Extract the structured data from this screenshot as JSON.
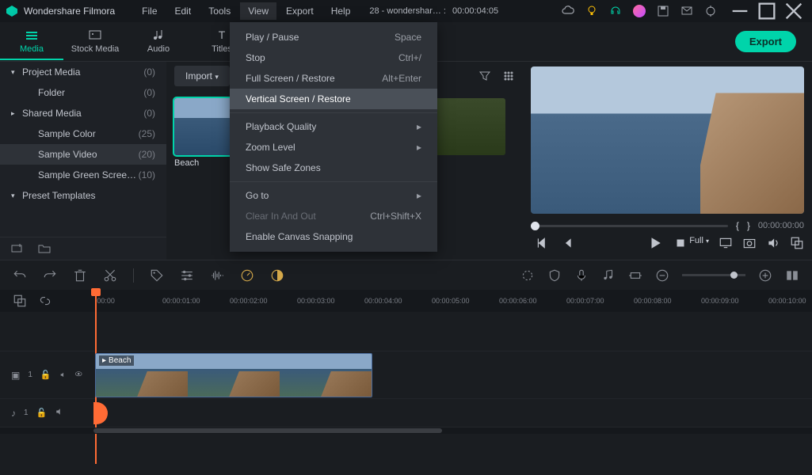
{
  "app_title": "Wondershare Filmora",
  "menubar": [
    "File",
    "Edit",
    "Tools",
    "View",
    "Export",
    "Help"
  ],
  "menubar_active_index": 3,
  "project_label": "28 - wondershar… :",
  "project_time": "00:00:04:05",
  "tabs": [
    "Media",
    "Stock Media",
    "Audio",
    "Titles"
  ],
  "tabs_active_index": 0,
  "export_label": "Export",
  "sidebar": [
    {
      "label": "Project Media",
      "count": "(0)",
      "arrow": "▾",
      "indent": false
    },
    {
      "label": "Folder",
      "count": "(0)",
      "arrow": "",
      "indent": true
    },
    {
      "label": "Shared Media",
      "count": "(0)",
      "arrow": "▸",
      "indent": false
    },
    {
      "label": "Sample Color",
      "count": "(25)",
      "arrow": "",
      "indent": true
    },
    {
      "label": "Sample Video",
      "count": "(20)",
      "arrow": "",
      "indent": true,
      "selected": true
    },
    {
      "label": "Sample Green Scree…",
      "count": "(10)",
      "arrow": "",
      "indent": true
    },
    {
      "label": "Preset Templates",
      "count": "",
      "arrow": "▾",
      "indent": false
    }
  ],
  "import_label": "Import",
  "thumbs": [
    {
      "label": "Beach",
      "class": "sea",
      "selected": true
    },
    {
      "label": "",
      "class": "dark-room",
      "selected": false
    },
    {
      "label": "",
      "class": "green-room",
      "selected": false
    }
  ],
  "scrub": {
    "brace_open": "{",
    "brace_close": "}",
    "time": "00:00:00:00"
  },
  "play_quality": "Full",
  "ruler": [
    "|00:00",
    "00:00:01:00",
    "00:00:02:00",
    "00:00:03:00",
    "00:00:04:00",
    "00:00:05:00",
    "00:00:06:00",
    "00:00:07:00",
    "00:00:08:00",
    "00:00:09:00",
    "00:00:10:00"
  ],
  "clip_label": "Beach",
  "track_video": "1",
  "track_audio": "1",
  "dropdown": [
    {
      "label": "Play / Pause",
      "shortcut": "Space"
    },
    {
      "label": "Stop",
      "shortcut": "Ctrl+/"
    },
    {
      "label": "Full Screen / Restore",
      "shortcut": "Alt+Enter"
    },
    {
      "label": "Vertical Screen / Restore",
      "highlighted": true
    },
    {
      "sep": true
    },
    {
      "label": "Playback Quality",
      "sub": "▸"
    },
    {
      "label": "Zoom Level",
      "sub": "▸"
    },
    {
      "label": "Show Safe Zones"
    },
    {
      "sep": true
    },
    {
      "label": "Go to",
      "sub": "▸"
    },
    {
      "label": "Clear In And Out",
      "shortcut": "Ctrl+Shift+X",
      "disabled": true
    },
    {
      "label": "Enable Canvas Snapping"
    }
  ]
}
